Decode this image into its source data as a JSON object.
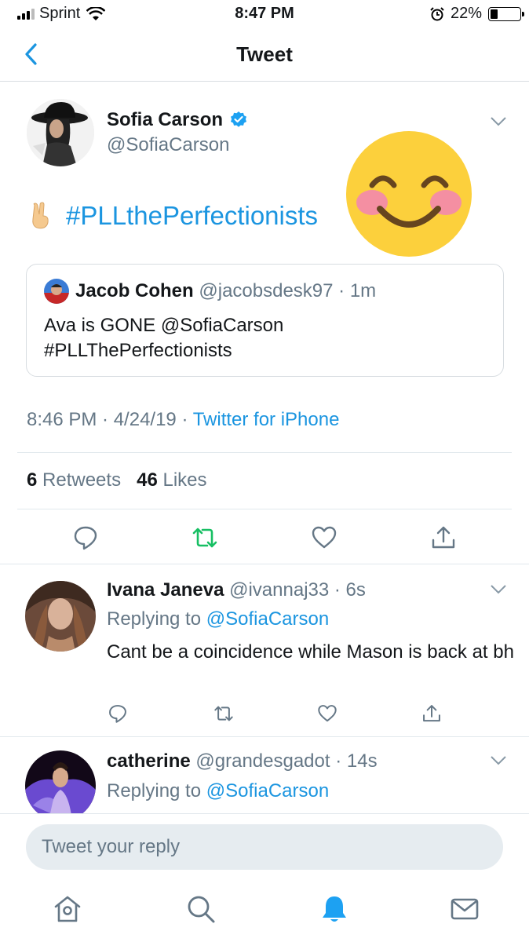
{
  "status_bar": {
    "carrier": "Sprint",
    "time": "8:47 PM",
    "battery_text": "22%",
    "battery_level": 0.22
  },
  "nav": {
    "title": "Tweet"
  },
  "tweet": {
    "name": "Sofia Carson",
    "handle": "@SofiaCarson",
    "hashtag": "#PLLthePerfectionists",
    "quote": {
      "name": "Jacob Cohen",
      "meta": "@jacobsdesk97 · 1m",
      "line1": "Ava is GONE @SofiaCarson",
      "line2": "#PLLThePerfectionists"
    },
    "time": "8:46 PM · 4/24/19 · ",
    "source": "Twitter for iPhone",
    "retweets": "6",
    "retweets_label": "Retweets",
    "likes": "46",
    "likes_label": "Likes"
  },
  "replies": [
    {
      "name": "Ivana Janeva",
      "meta": "@ivannaj33 · 6s",
      "replying_prefix": "Replying to ",
      "replying_to": "@SofiaCarson",
      "text": "Cant be a coincidence while Mason is back at bh"
    },
    {
      "name": "catherine",
      "meta": "@grandesgadot · 14s",
      "replying_prefix": "Replying to ",
      "replying_to": "@SofiaCarson"
    }
  ],
  "reply_box": {
    "placeholder": "Tweet your reply"
  },
  "colors": {
    "link": "#1b95e0",
    "retweet_active": "#17bf63",
    "muted": "#657786"
  },
  "icons": {
    "tabs": [
      "home-icon",
      "search-icon",
      "notifications-icon",
      "messages-icon"
    ],
    "actions": [
      "reply-icon",
      "retweet-icon",
      "like-icon",
      "share-icon"
    ]
  }
}
